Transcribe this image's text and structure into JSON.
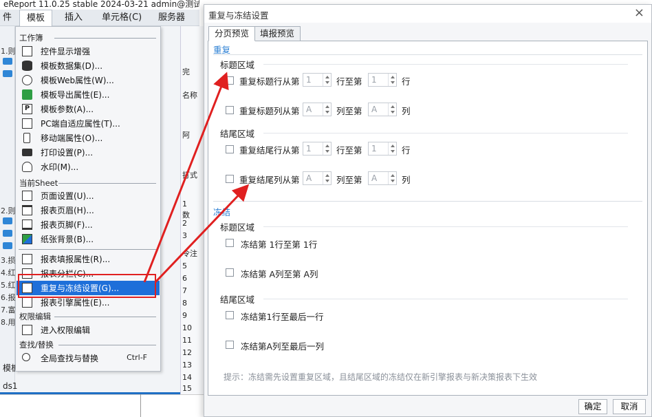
{
  "app": {
    "title": "eReport 11.0.25 stable 2024-03-21 admin@测试",
    "menubar": [
      "件",
      "模板",
      "插入",
      "单元格(C)",
      "服务器"
    ],
    "left_labels": [
      "1.则",
      "2.则",
      "3.损",
      "4.红",
      "5.红",
      "6.报",
      "7.富",
      "8.用"
    ],
    "bottom_label_1": "模板",
    "bottom_label_2": "ds1",
    "grid_labels": [
      "完",
      "名称",
      "阿",
      "打式",
      "1",
      "数",
      "2",
      "3",
      "令注",
      "5",
      "6",
      "7",
      "8",
      "9",
      "10",
      "11",
      "12",
      "13",
      "14",
      "15"
    ]
  },
  "menu": {
    "sections": {
      "workbook": "工作簿",
      "current_sheet": "当前Sheet",
      "permission": "权限编辑",
      "find": "查找/替换"
    },
    "items": [
      {
        "label": "控件显示增强",
        "icon": "control-display-icon"
      },
      {
        "label": "模板数据集(D)...",
        "icon": "database-icon"
      },
      {
        "label": "模板Web属性(W)...",
        "icon": "globe-icon"
      },
      {
        "label": "模板导出属性(E)...",
        "icon": "export-icon"
      },
      {
        "label": "模板参数(A)...",
        "icon": "parameter-icon"
      },
      {
        "label": "PC端自适应属性(T)...",
        "icon": "resize-icon"
      },
      {
        "label": "移动端属性(O)...",
        "icon": "mobile-icon"
      },
      {
        "label": "打印设置(P)...",
        "icon": "printer-icon"
      },
      {
        "label": "水印(M)...",
        "icon": "watermark-icon"
      },
      {
        "label": "页面设置(U)...",
        "icon": "page-setup-icon"
      },
      {
        "label": "报表页眉(H)...",
        "icon": "header-icon"
      },
      {
        "label": "报表页脚(F)...",
        "icon": "footer-icon"
      },
      {
        "label": "纸张背景(B)...",
        "icon": "image-icon"
      },
      {
        "label": "报表填报属性(R)...",
        "icon": "fill-attr-icon"
      },
      {
        "label": "报表分栏(C)...",
        "icon": "columns-icon"
      },
      {
        "label": "重复与冻结设置(G)...",
        "icon": "freeze-icon"
      },
      {
        "label": "报表引擎属性(E)...",
        "icon": "engine-icon"
      },
      {
        "label": "进入权限编辑",
        "icon": "permission-icon"
      },
      {
        "label": "全局查找与替换",
        "icon": "search-icon",
        "shortcut": "Ctrl-F"
      }
    ]
  },
  "dialog": {
    "title": "重复与冻结设置",
    "close": "×",
    "tabs": [
      "分页预览",
      "填报预览"
    ],
    "repeat": {
      "heading": "重复",
      "title_area": "标题区域",
      "footer_area": "结尾区域",
      "title_rows": {
        "label": "重复标题行从第",
        "from": "1",
        "to_label": "行至第",
        "to": "1",
        "unit": "行"
      },
      "title_cols": {
        "label": "重复标题列从第",
        "from": "A",
        "to_label": "列至第",
        "to": "A",
        "unit": "列"
      },
      "footer_rows": {
        "label": "重复结尾行从第",
        "from": "1",
        "to_label": "行至第",
        "to": "1",
        "unit": "行"
      },
      "footer_cols": {
        "label": "重复结尾列从第",
        "from": "A",
        "to_label": "列至第",
        "to": "A",
        "unit": "列"
      }
    },
    "freeze": {
      "heading": "冻结",
      "title_area": "标题区域",
      "footer_area": "结尾区域",
      "title_rows": "冻结第 1行至第 1行",
      "title_cols": "冻结第 A列至第 A列",
      "footer_rows": "冻结第1行至最后一行",
      "footer_cols": "冻结第A列至最后一列"
    },
    "hint": "提示：冻结需先设置重复区域，且结尾区域的冻结仅在新引擎报表与新决策报表下生效",
    "ok": "确定",
    "cancel": "取消"
  },
  "colors": {
    "accent": "#2b7fd3",
    "highlight": "#1e6fd9",
    "annotation": "#e02020"
  }
}
